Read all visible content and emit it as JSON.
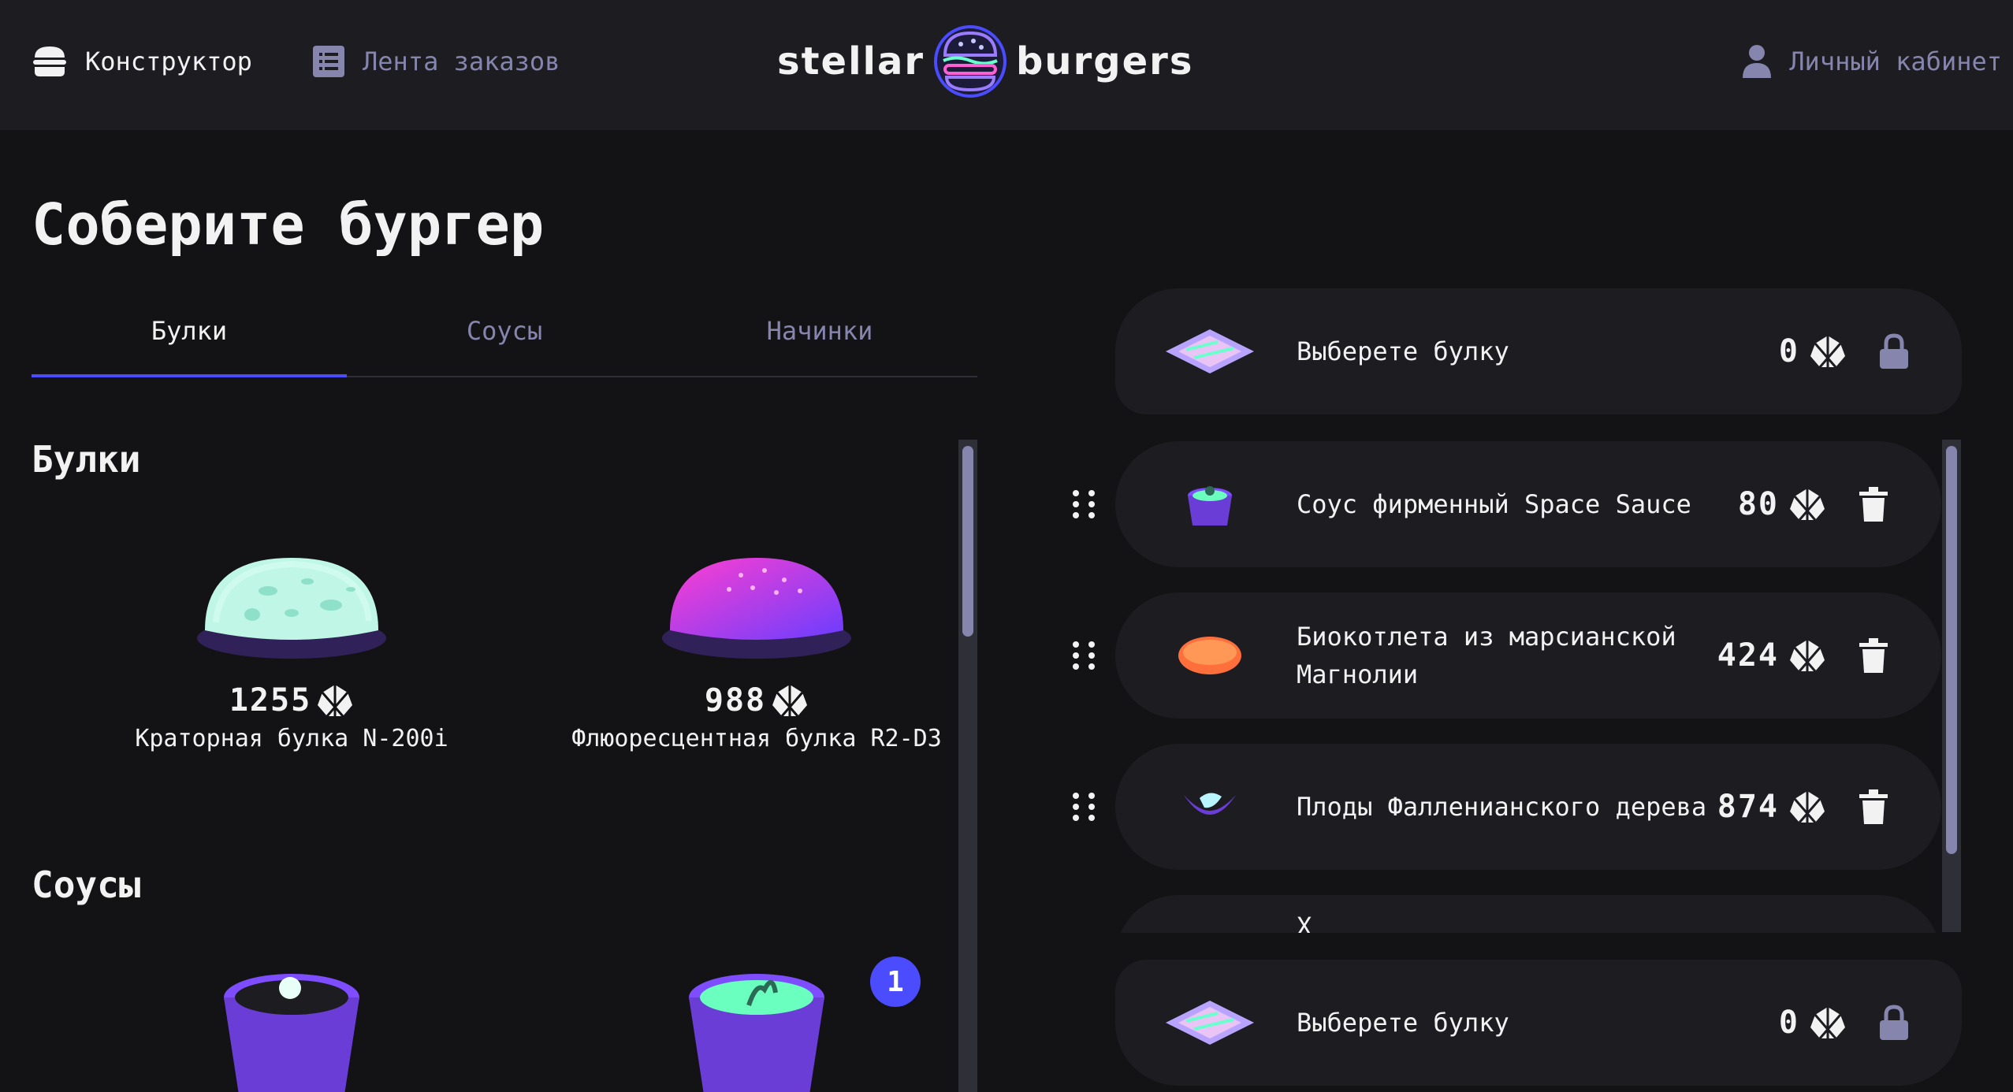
{
  "header": {
    "nav": {
      "constructor": "Конструктор",
      "feed": "Лента заказов",
      "account": "Личный кабинет"
    },
    "logo": {
      "left": "stellar",
      "right": "burgers"
    }
  },
  "page_title": "Соберите бургер",
  "tabs": [
    {
      "label": "Булки",
      "active": true
    },
    {
      "label": "Соусы",
      "active": false
    },
    {
      "label": "Начинки",
      "active": false
    }
  ],
  "sections": {
    "buns": {
      "title": "Булки",
      "items": [
        {
          "price": "1255",
          "name": "Краторная булка N-200i"
        },
        {
          "price": "988",
          "name": "Флюоресцентная булка R2-D3"
        }
      ]
    },
    "sauces": {
      "title": "Соусы",
      "counter": "1"
    }
  },
  "constructor": {
    "top_bun": {
      "name": "Выберете булку",
      "price": "0"
    },
    "fillings": [
      {
        "name": "Соус фирменный Space Sauce",
        "price": "80"
      },
      {
        "name": "Биокотлета из марсианской Магнолии",
        "price": "424"
      },
      {
        "name": "Плоды Фалленианского дерева",
        "price": "874"
      },
      {
        "name": "Х"
      }
    ],
    "bottom_bun": {
      "name": "Выберете булку",
      "price": "0"
    }
  },
  "colors": {
    "accent": "#4c4cff",
    "bg": "#131316",
    "panel": "#1c1c21",
    "inactive": "#8585ad"
  },
  "icons": [
    "burger-icon",
    "list-icon",
    "profile-icon",
    "currency-icon",
    "lock-icon",
    "trash-icon",
    "drag-icon"
  ]
}
